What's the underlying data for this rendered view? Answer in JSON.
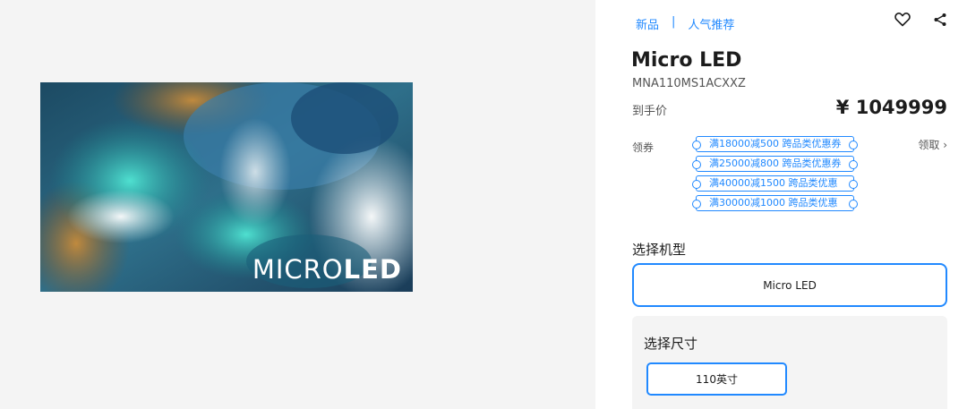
{
  "hero": {
    "overlay_light": "MICRO",
    "overlay_bold": "LED"
  },
  "breadcrumb": {
    "new": "新品",
    "separator": "|",
    "popular": "人气推荐"
  },
  "icons": {
    "favorite": "heart-icon",
    "share": "share-icon"
  },
  "product": {
    "title": "Micro LED",
    "code": "MNA110MS1ACXXZ",
    "price_label": "到手价",
    "price": "¥ 1049999"
  },
  "coupons": {
    "label": "领券",
    "claim": "领取 ›",
    "items": [
      "满18000减500 跨品类优惠券",
      "满25000减800 跨品类优惠券",
      "满40000减1500 跨品类优惠",
      "满30000减1000 跨品类优惠"
    ]
  },
  "model_select": {
    "title": "选择机型",
    "selected": "Micro LED"
  },
  "size_select": {
    "title": "选择尺寸",
    "selected": "110英寸"
  },
  "colors": {
    "accent": "#2189ff",
    "panel_bg": "#f4f4f4"
  }
}
